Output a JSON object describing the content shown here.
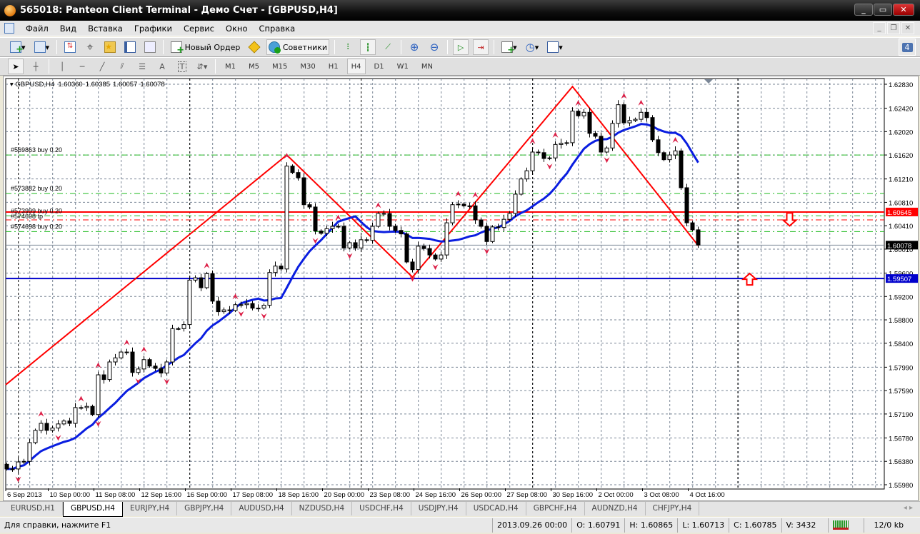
{
  "window": {
    "title": "565018: Panteon Client Terminal - Демо Счет - [GBPUSD,H4]"
  },
  "menu": [
    "Файл",
    "Вид",
    "Вставка",
    "Графики",
    "Сервис",
    "Окно",
    "Справка"
  ],
  "toolbar": {
    "new_order": "Новый Ордер",
    "experts": "Советники",
    "notifications": "4"
  },
  "timeframes": [
    "M1",
    "M5",
    "M15",
    "M30",
    "H1",
    "H4",
    "D1",
    "W1",
    "MN"
  ],
  "active_timeframe": "H4",
  "chart_header": {
    "symbol": "GBPUSD,H4",
    "open": "1.60360",
    "high": "1.60385",
    "low": "1.60057",
    "close": "1.60078"
  },
  "chart_data": {
    "type": "candlestick",
    "symbol": "GBPUSD",
    "timeframe": "H4",
    "ylim": [
      1.5598,
      1.6283
    ],
    "y_ticks": [
      "1.62830",
      "1.62420",
      "1.62020",
      "1.61620",
      "1.61210",
      "1.60810",
      "1.60410",
      "1.60010",
      "1.59600",
      "1.59200",
      "1.58800",
      "1.58400",
      "1.57990",
      "1.57590",
      "1.57190",
      "1.56780",
      "1.56380",
      "1.55980"
    ],
    "x_labels": [
      {
        "bar": 0,
        "text": "6 Sep 2013"
      },
      {
        "bar": 8,
        "text": "10 Sep 00:00"
      },
      {
        "bar": 16,
        "text": "11 Sep 08:00"
      },
      {
        "bar": 24,
        "text": "12 Sep 16:00"
      },
      {
        "bar": 32,
        "text": "16 Sep 00:00"
      },
      {
        "bar": 40,
        "text": "17 Sep 08:00"
      },
      {
        "bar": 48,
        "text": "18 Sep 16:00"
      },
      {
        "bar": 56,
        "text": "20 Sep 00:00"
      },
      {
        "bar": 64,
        "text": "23 Sep 08:00"
      },
      {
        "bar": 72,
        "text": "24 Sep 16:00"
      },
      {
        "bar": 80,
        "text": "26 Sep 00:00"
      },
      {
        "bar": 88,
        "text": "27 Sep 08:00"
      },
      {
        "bar": 96,
        "text": "30 Sep 16:00"
      },
      {
        "bar": 104,
        "text": "2 Oct 00:00"
      },
      {
        "bar": 112,
        "text": "3 Oct 08:00"
      },
      {
        "bar": 120,
        "text": "4 Oct 16:00"
      }
    ],
    "first_open": 1.5633,
    "closes": [
      1.5625,
      1.5625,
      1.5637,
      1.5638,
      1.567,
      1.5691,
      1.5703,
      1.5691,
      1.5695,
      1.5702,
      1.5707,
      1.5703,
      1.573,
      1.573,
      1.5732,
      1.5718,
      1.5786,
      1.5778,
      1.5808,
      1.5815,
      1.5825,
      1.5825,
      1.579,
      1.5796,
      1.5812,
      1.5801,
      1.5797,
      1.5789,
      1.5808,
      1.5865,
      1.5865,
      1.5872,
      1.5948,
      1.5952,
      1.5935,
      1.5959,
      1.5912,
      1.5894,
      1.5897,
      1.5896,
      1.5906,
      1.5906,
      1.5908,
      1.59,
      1.59,
      1.5905,
      1.5961,
      1.5972,
      1.5967,
      1.6143,
      1.6132,
      1.6123,
      1.6077,
      1.6073,
      1.6032,
      1.6028,
      1.6036,
      1.604,
      1.604,
      1.6003,
      1.6012,
      1.6003,
      1.6017,
      1.6016,
      1.604,
      1.6062,
      1.6062,
      1.604,
      1.6033,
      1.6027,
      1.5979,
      1.5966,
      1.6006,
      1.6002,
      1.5991,
      1.5984,
      1.5991,
      1.6046,
      1.6077,
      1.6078,
      1.6075,
      1.6075,
      1.6051,
      1.604,
      1.6014,
      1.6039,
      1.6038,
      1.6052,
      1.6062,
      1.6095,
      1.6121,
      1.6135,
      1.6167,
      1.6166,
      1.6156,
      1.6157,
      1.618,
      1.6182,
      1.6183,
      1.6237,
      1.6229,
      1.6235,
      1.6199,
      1.6194,
      1.6167,
      1.6174,
      1.6216,
      1.6248,
      1.6217,
      1.6221,
      1.6223,
      1.6235,
      1.6226,
      1.6188,
      1.6166,
      1.6154,
      1.6162,
      1.6169,
      1.6106,
      1.6046,
      1.6034,
      1.6008
    ],
    "ma_period": 13,
    "zigzag": [
      {
        "bar": 0,
        "price": 1.5769
      },
      {
        "bar": 49,
        "price": 1.6162
      },
      {
        "bar": 71,
        "price": 1.5953
      },
      {
        "bar": 99,
        "price": 1.6279
      },
      {
        "bar": 121,
        "price": 1.6007
      }
    ],
    "fractals_up": [
      6,
      13,
      16,
      21,
      24,
      35,
      40,
      49,
      58,
      65,
      79,
      82,
      92,
      96,
      100,
      108,
      111,
      117
    ],
    "fractals_down": [
      2,
      9,
      16,
      23,
      28,
      41,
      45,
      54,
      60,
      71,
      75,
      84,
      95,
      105
    ],
    "order_lines": [
      {
        "label": "#569863 buy 0.20",
        "price": 1.6162,
        "kind": "entry"
      },
      {
        "label": "#573882 buy 0.20",
        "price": 1.6096,
        "kind": "entry"
      },
      {
        "label": "#573999 buy 0.20",
        "price": 1.6058,
        "kind": "entry"
      },
      {
        "label": "#574698 tp",
        "price": 1.6051,
        "kind": "tp"
      },
      {
        "label": "#574698 buy 0.20",
        "price": 1.6031,
        "kind": "entry"
      }
    ],
    "hlines": [
      {
        "price": 1.60645,
        "label": "1.60645",
        "color": "#ff0000"
      },
      {
        "price": 1.59507,
        "label": "1.59507",
        "color": "#0000cc"
      },
      {
        "price": 1.60078,
        "label": "1.60078",
        "color": "#000000",
        "bid": true
      }
    ],
    "arrows": [
      {
        "bar": 137,
        "price": 1.6053,
        "dir": "down"
      },
      {
        "bar": 130,
        "price": 1.5952,
        "dir": "up"
      }
    ],
    "colors": {
      "zigzag": "#ff0000",
      "ma": "#0a1ee0",
      "fractal": "#dc1e46",
      "entry": "#22bb22",
      "tp": "#ff0000",
      "grid": "#7a8696"
    }
  },
  "tabs": [
    "EURUSD,H1",
    "GBPUSD,H4",
    "EURJPY,H4",
    "GBPJPY,H4",
    "AUDUSD,H4",
    "NZDUSD,H4",
    "USDCHF,H4",
    "USDJPY,H4",
    "USDCAD,H4",
    "GBPCHF,H4",
    "AUDNZD,H4",
    "CHFJPY,H4"
  ],
  "active_tab": "GBPUSD,H4",
  "status": {
    "help": "Для справки, нажмите F1",
    "datetime": "2013.09.26 00:00",
    "open": "O: 1.60791",
    "high": "H: 1.60865",
    "low": "L: 1.60713",
    "close": "C: 1.60785",
    "volume": "V: 3432",
    "traffic": "12/0 kb"
  }
}
